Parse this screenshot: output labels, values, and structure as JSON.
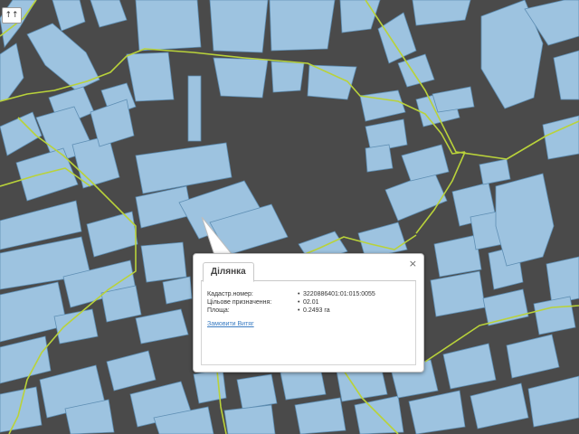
{
  "map": {
    "background_color": "#4a4a4a",
    "parcel_fill_color": "#9dc3e0",
    "parcel_stroke_color": "#5f8fb4",
    "boundary_color": "#b9d23a"
  },
  "nav": {
    "button_label": "↑↑",
    "icon": "navigate-icon"
  },
  "popup": {
    "tab_label": "Ділянка",
    "close_label": "×",
    "rows": [
      {
        "label": "Кадастр.номер:",
        "bullet": "•",
        "value": "3220886401:01:015:0055"
      },
      {
        "label": "Цільове призначення:",
        "bullet": "•",
        "value": "02.01"
      },
      {
        "label": "Площа:",
        "bullet": "•",
        "value": "0.2493 га"
      }
    ],
    "order_link": "Замовити Витяг"
  }
}
